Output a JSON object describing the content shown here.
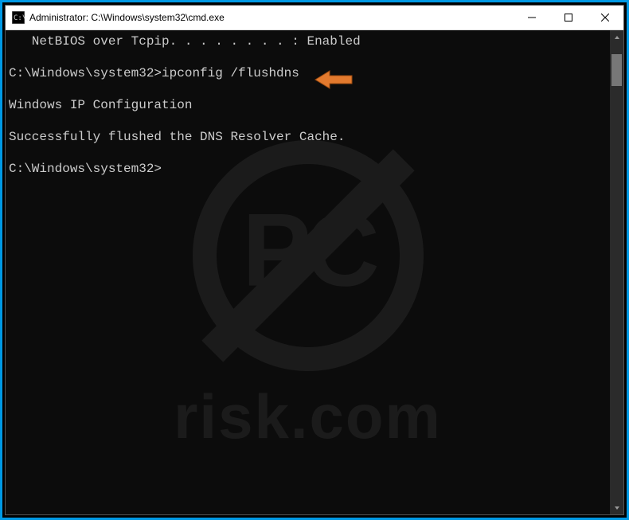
{
  "window": {
    "title": "Administrator: C:\\Windows\\system32\\cmd.exe"
  },
  "terminal": {
    "lines": [
      "   NetBIOS over Tcpip. . . . . . . . : Enabled",
      "",
      "C:\\Windows\\system32>ipconfig /flushdns",
      "",
      "Windows IP Configuration",
      "",
      "Successfully flushed the DNS Resolver Cache.",
      "",
      "C:\\Windows\\system32>"
    ]
  },
  "watermark": {
    "logo_letters": "PC",
    "text": "risk.com"
  },
  "annotation": {
    "arrow_color": "#e37a2e"
  }
}
